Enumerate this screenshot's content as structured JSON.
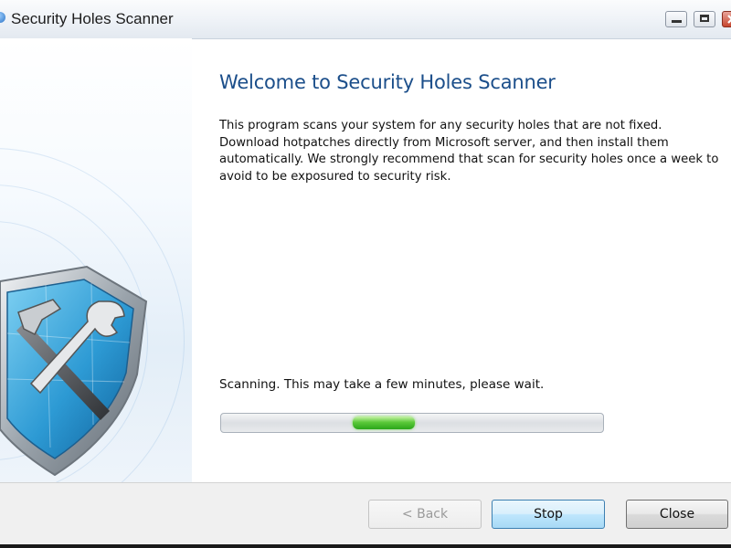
{
  "window": {
    "title": "Security Holes Scanner"
  },
  "content": {
    "heading": "Welcome to Security Holes Scanner",
    "description_lines": [
      "This program scans your system for any security holes that are not fixed.",
      "Download hotpatches directly from Microsoft server, and then install them",
      "automatically. We strongly recommend that scan for security holes once a week to",
      "avoid to be exposured to security risk."
    ],
    "status": "Scanning. This may take a few minutes, please wait."
  },
  "progress": {
    "style": "marquee",
    "color": "#3fbf2a"
  },
  "buttons": {
    "back_label": "< Back",
    "stop_label": "Stop",
    "close_label": "Close"
  },
  "icons": {
    "app": "app-icon",
    "banner": "shield-hammer-wrench-icon",
    "minimize": "minimize-icon",
    "maximize": "maximize-icon",
    "close": "close-icon"
  },
  "colors": {
    "heading": "#1b4e8a",
    "accent": "#3c7fb1",
    "titlebar": "#eef2f7"
  }
}
